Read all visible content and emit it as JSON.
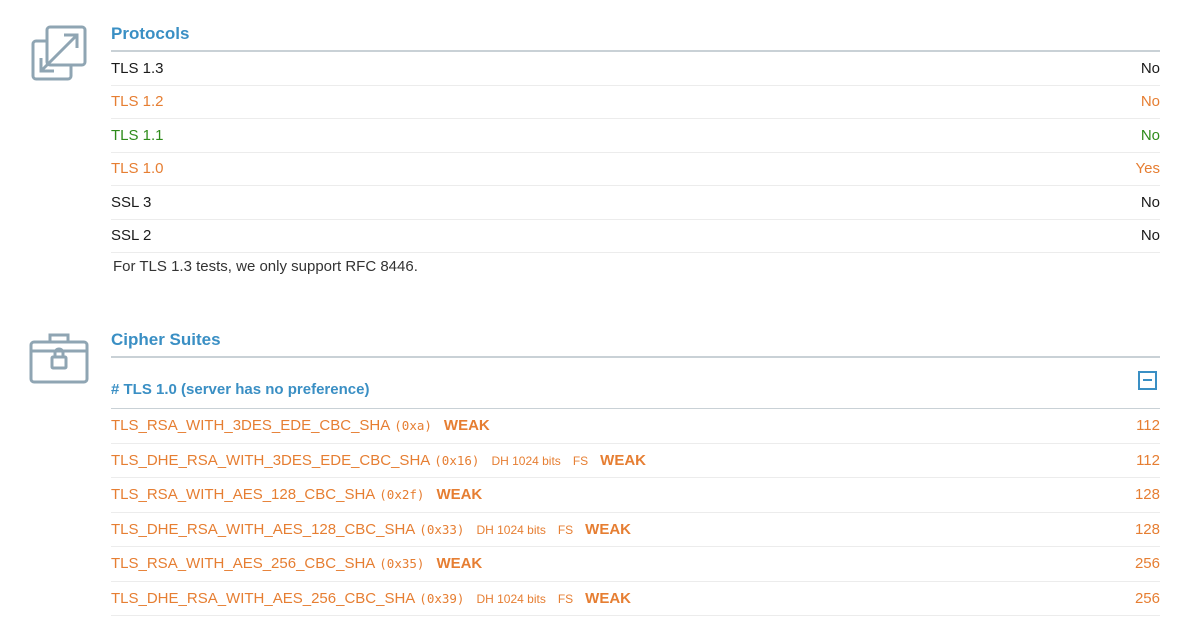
{
  "protocols": {
    "title": "Protocols",
    "rows": [
      {
        "name": "TLS 1.3",
        "value": "No",
        "color": "#1a1a1a"
      },
      {
        "name": "TLS 1.2",
        "value": "No",
        "color": "#e67e32"
      },
      {
        "name": "TLS 1.1",
        "value": "No",
        "color": "#2e8b1a"
      },
      {
        "name": "TLS 1.0",
        "value": "Yes",
        "color": "#e67e32"
      },
      {
        "name": "SSL 3",
        "value": "No",
        "color": "#1a1a1a"
      },
      {
        "name": "SSL 2",
        "value": "No",
        "color": "#1a1a1a"
      }
    ],
    "note": "For TLS 1.3 tests, we only support RFC 8446.",
    "icon": "expand-arrows-icon"
  },
  "cipher_suites": {
    "title": "Cipher Suites",
    "icon": "lock-briefcase-icon",
    "group_header": "# TLS 1.0 (server has no preference)",
    "rows": [
      {
        "name": "TLS_RSA_WITH_3DES_EDE_CBC_SHA",
        "code": "(0xa)",
        "dh": "",
        "fs": "",
        "strength": "WEAK",
        "bits": "112"
      },
      {
        "name": "TLS_DHE_RSA_WITH_3DES_EDE_CBC_SHA",
        "code": "(0x16)",
        "dh": "DH 1024 bits",
        "fs": "FS",
        "strength": "WEAK",
        "bits": "112"
      },
      {
        "name": "TLS_RSA_WITH_AES_128_CBC_SHA",
        "code": "(0x2f)",
        "dh": "",
        "fs": "",
        "strength": "WEAK",
        "bits": "128"
      },
      {
        "name": "TLS_DHE_RSA_WITH_AES_128_CBC_SHA",
        "code": "(0x33)",
        "dh": "DH 1024 bits",
        "fs": "FS",
        "strength": "WEAK",
        "bits": "128"
      },
      {
        "name": "TLS_RSA_WITH_AES_256_CBC_SHA",
        "code": "(0x35)",
        "dh": "",
        "fs": "",
        "strength": "WEAK",
        "bits": "256"
      },
      {
        "name": "TLS_DHE_RSA_WITH_AES_256_CBC_SHA",
        "code": "(0x39)",
        "dh": "DH 1024 bits",
        "fs": "FS",
        "strength": "WEAK",
        "bits": "256"
      }
    ]
  },
  "colors": {
    "accent": "#3a8fc4",
    "warning": "#e67e32",
    "good": "#2e8b1a",
    "icon": "#8fa5b3"
  }
}
